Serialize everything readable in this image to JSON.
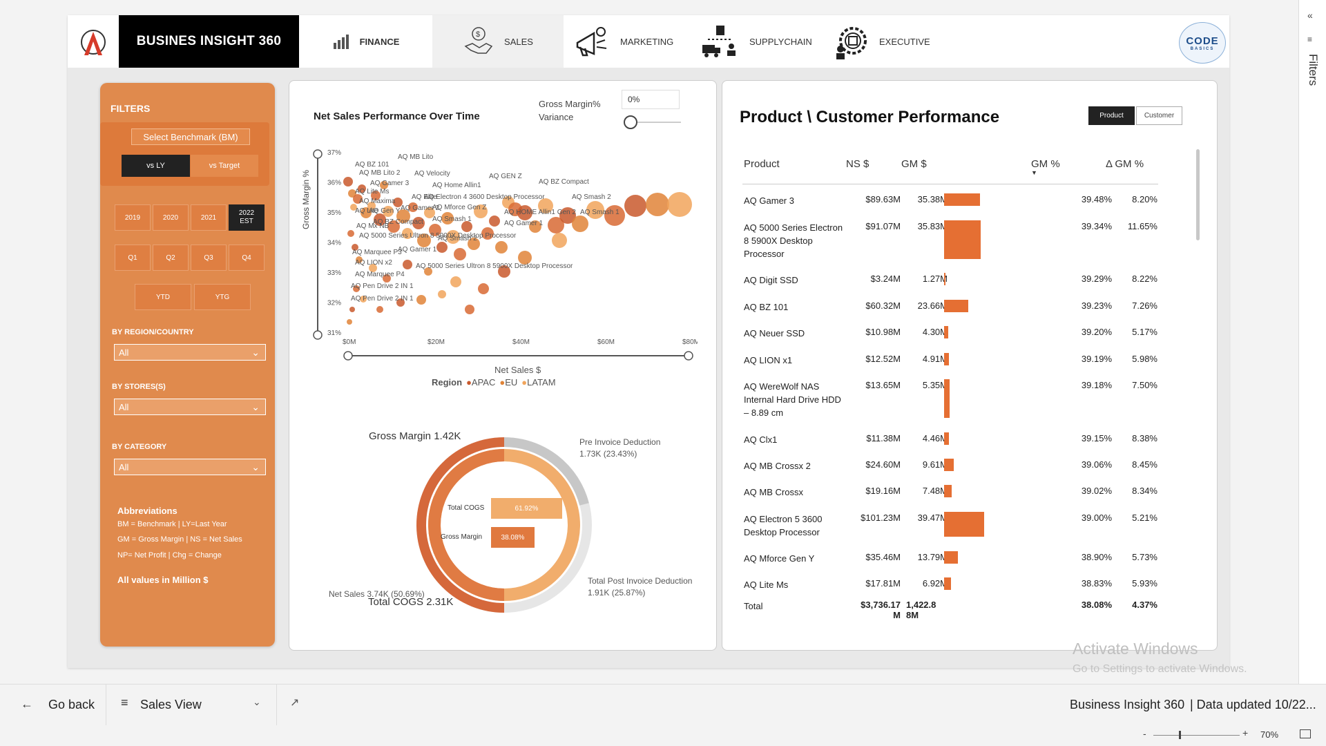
{
  "header": {
    "brand": "BUSINES INSIGHT 360",
    "nav": [
      {
        "label": "FINANCE",
        "icon": "finance-chart-icon"
      },
      {
        "label": "SALES",
        "icon": "handshake-dollar-icon"
      },
      {
        "label": "MARKETING",
        "icon": "megaphone-icon"
      },
      {
        "label": "SUPPLYCHAIN",
        "icon": "delivery-truck-icon"
      },
      {
        "label": "EXECUTIVE",
        "icon": "executive-gear-icon"
      }
    ],
    "partner_logo": {
      "big": "CODE",
      "small": "BASICS"
    }
  },
  "filters": {
    "title": "FILTERS",
    "benchmark_label": "Select Benchmark (BM)",
    "benchmark_options": [
      "vs LY",
      "vs Target"
    ],
    "benchmark_selected": "vs LY",
    "years": [
      "2019",
      "2020",
      "2021",
      "2022 EST"
    ],
    "year_selected": "2022 EST",
    "year_sel_lines": [
      "2022",
      "EST"
    ],
    "quarters": [
      "Q1",
      "Q2",
      "Q3",
      "Q4"
    ],
    "ytd": [
      "YTD",
      "YTG"
    ],
    "region_label": "BY REGION/COUNTRY",
    "region_value": "All",
    "stores_label": "BY STORES(S)",
    "stores_value": "All",
    "category_label": "BY CATEGORY",
    "category_value": "All",
    "abbr_title": "Abbreviations",
    "abbr_lines": [
      "BM = Benchmark | LY=Last Year",
      "GM = Gross Margin | NS = Net Sales",
      "NP= Net Profit | Chg = Change"
    ],
    "all_values": "All values in Million $"
  },
  "scatter": {
    "title": "Net Sales Performance Over Time",
    "gm_variance_label_1": "Gross Margin%",
    "gm_variance_label_2": "Variance",
    "gm_variance_value": "0%",
    "y_axis_title": "Gross Margin %",
    "x_axis_title": "Net Sales $",
    "y_ticks": [
      "37%",
      "36%",
      "35%",
      "34%",
      "33%",
      "32%",
      "31%"
    ],
    "x_ticks": [
      "$0M",
      "$20M",
      "$40M",
      "$60M",
      "$80M"
    ],
    "legend_title": "Region",
    "legend": [
      "APAC",
      "EU",
      "LATAM"
    ],
    "labels": [
      "AQ BZ 101",
      "AQ MB Lito",
      "AQ MB Lito 2",
      "AQ Velocity",
      "AQ Gamer 3",
      "AQ Home Allin1",
      "AQ GEN Z",
      "AQ BZ Compact",
      "AQ Lite Ms",
      "AQ Maxima",
      "AQ Elite",
      "AQ Electron 4 3600 Desktop Processor",
      "AQ Smash 2",
      "AQ Lite",
      "AQ Gen Y",
      "AQ Gamer 2",
      "AQ Mforce Gen Z",
      "AQ HOME Allin1 Gen 2",
      "AQ Smash 1",
      "AQ BZ Compact",
      "AQ Gamer 1",
      "AQ Mx NB",
      "AQ 5000 Series Ultron 8 5900X Desktop Processor",
      "AQ Smash 2",
      "AQ Marquee P3",
      "AQ Gamer 1",
      "AQ LION x2",
      "AQ 5000 Series Ultron 8 5900X Desktop Processor",
      "AQ Marquee P4",
      "AQ Pen Drive 2 IN 1",
      "AQ Pen Drive 2 IN 1",
      "AQ Smash 1"
    ]
  },
  "donut": {
    "gross_margin_label": "Gross Margin 1.42K",
    "pre_invoice_label": "Pre Invoice Deduction",
    "pre_invoice_value": "1.73K (23.43%)",
    "post_invoice_label": "Total Post Invoice Deduction",
    "post_invoice_value": "1.91K (25.87%)",
    "net_sales_label": "Net Sales 3.74K (50.69%)",
    "total_cogs_label": "Total COGS 2.31K",
    "bars": [
      {
        "label": "Total COGS",
        "value": "61.92%",
        "pct": 61.92
      },
      {
        "label": "Gross Margin",
        "value": "38.08%",
        "pct": 38.08
      }
    ]
  },
  "table": {
    "title": "Product \\ Customer Performance",
    "toggle": [
      "Product",
      "Customer"
    ],
    "toggle_selected": "Product",
    "headers": [
      "Product",
      "NS $",
      "GM $",
      "GM %",
      "Δ GM %"
    ],
    "rows": [
      {
        "product": "AQ Gamer 3",
        "ns": "$89.63M",
        "gm": "35.38M",
        "gm_num": 35.38,
        "gmp": "39.48%",
        "dgm": "8.20%"
      },
      {
        "product": "AQ 5000 Series Electron 8 5900X Desktop Processor",
        "ns": "$91.07M",
        "gm": "35.83M",
        "gm_num": 35.83,
        "gmp": "39.34%",
        "dgm": "11.65%"
      },
      {
        "product": "AQ Digit SSD",
        "ns": "$3.24M",
        "gm": "1.27M",
        "gm_num": 1.27,
        "gmp": "39.29%",
        "dgm": "8.22%"
      },
      {
        "product": "AQ BZ 101",
        "ns": "$60.32M",
        "gm": "23.66M",
        "gm_num": 23.66,
        "gmp": "39.23%",
        "dgm": "7.26%"
      },
      {
        "product": "AQ Neuer SSD",
        "ns": "$10.98M",
        "gm": "4.30M",
        "gm_num": 4.3,
        "gmp": "39.20%",
        "dgm": "5.17%"
      },
      {
        "product": "AQ LION x1",
        "ns": "$12.52M",
        "gm": "4.91M",
        "gm_num": 4.91,
        "gmp": "39.19%",
        "dgm": "5.98%"
      },
      {
        "product": "AQ WereWolf NAS Internal Hard Drive HDD – 8.89 cm",
        "ns": "$13.65M",
        "gm": "5.35M",
        "gm_num": 5.35,
        "gmp": "39.18%",
        "dgm": "7.50%"
      },
      {
        "product": "AQ Clx1",
        "ns": "$11.38M",
        "gm": "4.46M",
        "gm_num": 4.46,
        "gmp": "39.15%",
        "dgm": "8.38%"
      },
      {
        "product": "AQ MB Crossx 2",
        "ns": "$24.60M",
        "gm": "9.61M",
        "gm_num": 9.61,
        "gmp": "39.06%",
        "dgm": "8.45%"
      },
      {
        "product": "AQ MB Crossx",
        "ns": "$19.16M",
        "gm": "7.48M",
        "gm_num": 7.48,
        "gmp": "39.02%",
        "dgm": "8.34%"
      },
      {
        "product": "AQ Electron 5 3600 Desktop Processor",
        "ns": "$101.23M",
        "gm": "39.47M",
        "gm_num": 39.47,
        "gmp": "39.00%",
        "dgm": "5.21%"
      },
      {
        "product": "AQ Mforce Gen Y",
        "ns": "$35.46M",
        "gm": "13.79M",
        "gm_num": 13.79,
        "gmp": "38.90%",
        "dgm": "5.73%"
      },
      {
        "product": "AQ Lite Ms",
        "ns": "$17.81M",
        "gm": "6.92M",
        "gm_num": 6.92,
        "gmp": "38.83%",
        "dgm": "5.93%"
      }
    ],
    "total": {
      "label": "Total",
      "ns_lines": [
        "$3,736.17",
        "M"
      ],
      "gm_lines": [
        "1,422.8",
        "8M"
      ],
      "gmp": "38.08%",
      "dgm": "4.37%"
    }
  },
  "watermark": {
    "line1": "Activate Windows",
    "line2": "Go to Settings to activate Windows."
  },
  "bottom": {
    "go_back": "Go back",
    "view": "Sales View",
    "report_name": "Business Insight 360",
    "data_updated": "| Data updated 10/22...",
    "zoom": "70%"
  },
  "side": {
    "filters_label": "Filters"
  },
  "colors": {
    "accent": "#e56f33",
    "panel": "#e08a4d",
    "dark": "#222222"
  }
}
